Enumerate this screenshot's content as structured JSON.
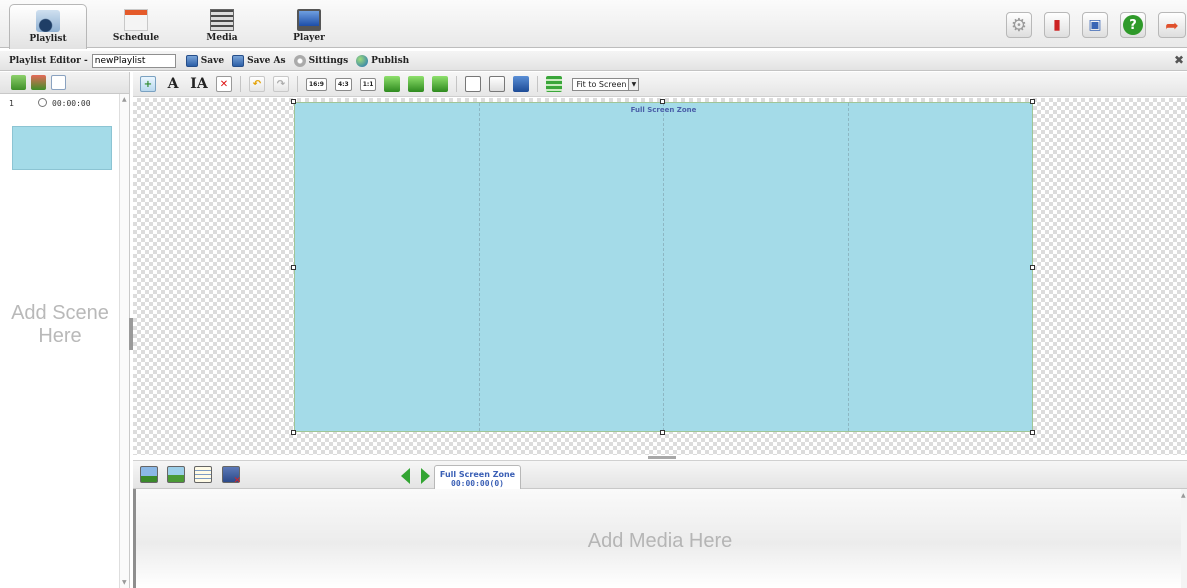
{
  "nav": {
    "tabs": [
      {
        "label": "Playlist",
        "icon": "playlist-icon",
        "active": true
      },
      {
        "label": "Schedule",
        "icon": "calendar-icon",
        "active": false
      },
      {
        "label": "Media",
        "icon": "film-icon",
        "active": false
      },
      {
        "label": "Player",
        "icon": "monitor-icon",
        "active": false
      }
    ],
    "right_buttons": [
      "settings-gear-icon",
      "cards-icon",
      "monitor-search-icon",
      "help-icon",
      "logout-icon"
    ],
    "help_glyph": "?"
  },
  "editor": {
    "title": "Playlist Editor -",
    "playlist_name": "newPlaylist",
    "save_label": "Save",
    "save_as_label": "Save As",
    "settings_label": "Sittings",
    "publish_label": "Publish",
    "close_glyph": "✖"
  },
  "scenes": {
    "items": [
      {
        "number": "1",
        "duration": "00:00:00"
      }
    ],
    "empty_hint": "Add Scene Here"
  },
  "canvas_toolbar": {
    "ratios": [
      "16:9",
      "4:3",
      "1:1"
    ],
    "fit_value": "Fit to Screen"
  },
  "canvas": {
    "zone_label": "Full Screen Zone",
    "zone_color": "#a4dbe8"
  },
  "media_panel": {
    "zone_tab_name": "Full Screen Zone",
    "zone_tab_time": "00:00:00(0)",
    "empty_hint": "Add Media Here"
  },
  "colors": {
    "accent_green": "#33a533",
    "zone_label_blue": "#4a5fa8"
  }
}
